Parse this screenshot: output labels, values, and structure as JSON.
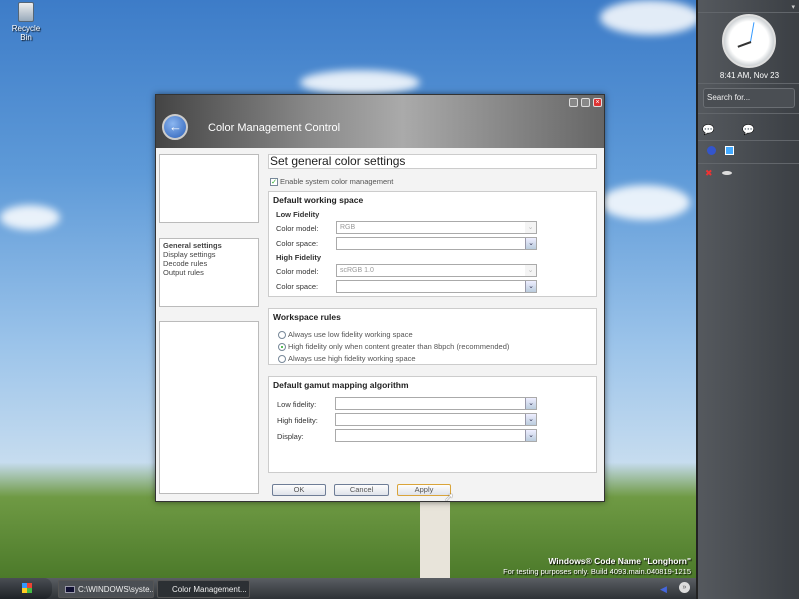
{
  "desktop": {
    "recycle_bin": "Recycle Bin",
    "watermark_line1": "Windows® Code Name \"Longhorn\"",
    "watermark_line2": "For testing purposes only. Build 4093.main.040819-1215"
  },
  "sidebar": {
    "clock_text": "8:41 AM, Nov 23",
    "search_placeholder": "Search for..."
  },
  "taskbar": {
    "items": [
      {
        "label": "C:\\WINDOWS\\syste..."
      },
      {
        "label": "Color Management..."
      }
    ]
  },
  "dialog": {
    "title": "Color Management Control",
    "nav": [
      "General settings",
      "Display settings",
      "Decode rules",
      "Output rules"
    ],
    "heading": "Set general color settings",
    "enable_label": "Enable system color management",
    "enable_checked": true,
    "working_space": {
      "title": "Default working space",
      "low_title": "Low Fidelity",
      "high_title": "High Fidelity",
      "color_model_label": "Color model:",
      "color_space_label": "Color space:",
      "low_model": "RGB",
      "low_space": "",
      "high_model": "scRGB 1.0",
      "high_space": ""
    },
    "workspace_rules": {
      "title": "Workspace rules",
      "options": [
        "Always use low fidelity working space",
        "High fidelity only when content greater than 8bpch (recommended)",
        "Always use high fidelity working space"
      ],
      "selected": 1
    },
    "gamut": {
      "title": "Default gamut mapping algorithm",
      "low_label": "Low fidelity:",
      "high_label": "High fidelity:",
      "display_label": "Display:",
      "low": "",
      "high": "",
      "display": ""
    },
    "buttons": {
      "ok": "OK",
      "cancel": "Cancel",
      "apply": "Apply"
    }
  }
}
